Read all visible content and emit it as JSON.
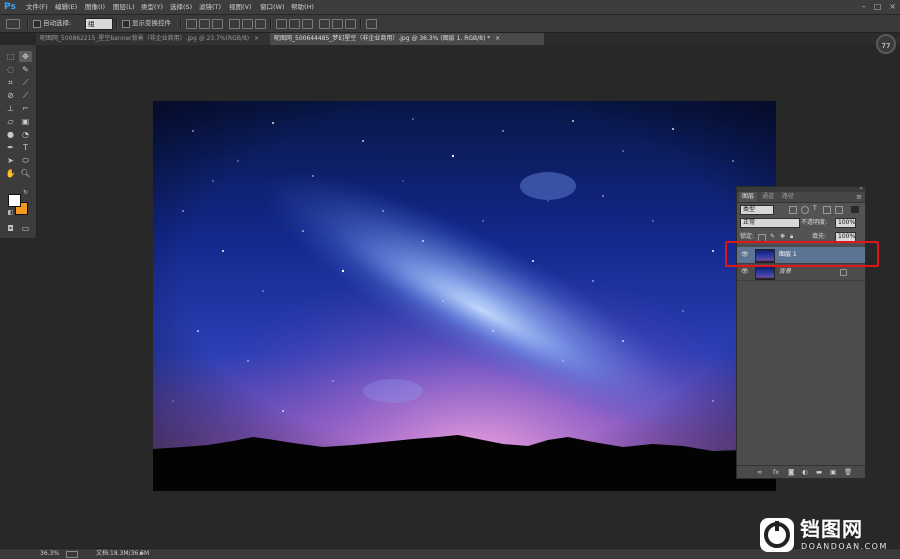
{
  "app": {
    "logo": "Ps"
  },
  "menu": [
    "文件(F)",
    "编辑(E)",
    "图像(I)",
    "图层(L)",
    "类型(Y)",
    "选择(S)",
    "滤镜(T)",
    "视图(V)",
    "窗口(W)",
    "帮助(H)"
  ],
  "window_controls": {
    "minimize": "–",
    "maximize": "□",
    "close": "×"
  },
  "options_bar": {
    "auto_select_label": "自动选择:",
    "auto_select_value": "组",
    "show_transform_label": "显示变换控件"
  },
  "tabs": [
    "昵图网_500862215_星空banner背景（非企业商用）.jpg @ 23.7%(RGB/8)",
    "昵图网_500644485_梦幻星空（非企业商用）.jpg @ 36.3% (图层 1, RGB/8) *"
  ],
  "tabs_close": [
    "×",
    "×"
  ],
  "navigator_zoom": "77",
  "layers_panel": {
    "tabs": [
      "图层",
      "通道",
      "路径"
    ],
    "kind_filter": "类型",
    "blend_mode": "正常",
    "opacity_label": "不透明度:",
    "opacity_value": "100%",
    "lock_label": "锁定:",
    "fill_label": "填充:",
    "fill_value": "100%",
    "layers": [
      {
        "name": "图层 1",
        "selected": true,
        "visible": true
      },
      {
        "name": "背景",
        "selected": false,
        "visible": true,
        "locked": true
      }
    ],
    "footer_icons": [
      "link-icon",
      "fx-icon",
      "mask-icon",
      "adjustment-icon",
      "group-icon",
      "new-layer-icon",
      "trash-icon"
    ]
  },
  "status_bar": {
    "zoom": "36.3%",
    "doc_info": "文档:18.3M/36.6M"
  },
  "watermark": {
    "title": "铛图网",
    "subtitle": "DOANDOAN.COM"
  },
  "colors": {
    "foreground": "#ffffff",
    "background": "#f39a1e",
    "highlight": "#e0151b",
    "selected_layer": "#5d7394"
  }
}
